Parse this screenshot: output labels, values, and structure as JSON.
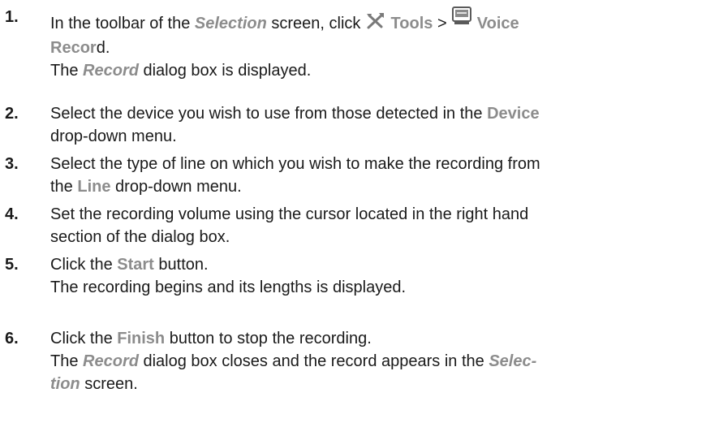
{
  "steps": [
    {
      "number": "1.",
      "t1": "In the toolbar of the ",
      "t2": "Selection",
      "t3": " screen, click ",
      "t4": "Tools",
      "t5": " > ",
      "t6a": "Voice",
      "t6b": "Recor",
      "t7": "d.",
      "result_a": "The ",
      "result_b": "Record",
      "result_c": " dialog box is displayed."
    },
    {
      "number": "2.",
      "t1": "Select the device you wish to use from those detected in the ",
      "t2": "Device",
      "t3": "drop-down menu."
    },
    {
      "number": "3.",
      "t1": "Select the type of line on which you wish to make the recording from",
      "t2": "the ",
      "t3": "Line",
      "t4": " drop-down menu."
    },
    {
      "number": "4.",
      "t1": "Set the recording volume using the cursor located in the right hand",
      "t2": "section of the dialog box."
    },
    {
      "number": "5.",
      "t1": "Click the ",
      "t2": "Start",
      "t3": " button.",
      "result": "The recording begins and its lengths is displayed."
    },
    {
      "number": "6.",
      "t1": "Click the ",
      "t2": "Finish",
      "t3": " button to stop the recording.",
      "r1": "The ",
      "r2": "Record",
      "r3": " dialog box closes and the record appears in the ",
      "r4": "Selec-",
      "r5": "tion",
      "r6": " screen."
    }
  ],
  "icons": {
    "tools": "tools-icon",
    "voice_record": "voice-record-icon"
  },
  "colors": {
    "text": "#1a1a1a",
    "ui_term": "#8c8c8c"
  }
}
